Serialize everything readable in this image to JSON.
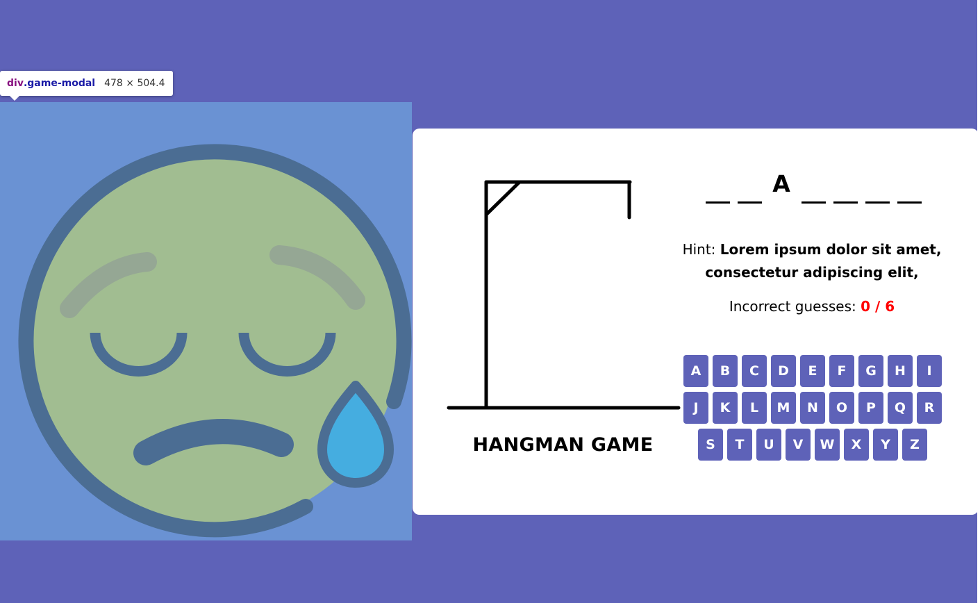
{
  "devtools_tooltip": {
    "tag": "div",
    "class_name": ".game-modal",
    "size": "478 × 504.4"
  },
  "emoji": {
    "icon": "sad-face-with-sweat-drop-icon",
    "colors": {
      "panel": "#6a92d3",
      "face": "#a1bd91",
      "outline": "#4b6d93",
      "brow": "#95a794",
      "tear": "#45ade0"
    }
  },
  "game": {
    "title": "HANGMAN GAME",
    "word_slots": [
      "",
      "",
      "A",
      "",
      "",
      "",
      ""
    ],
    "hint_label": "Hint: ",
    "hint_text": "Lorem ipsum dolor sit amet, consectetur adipiscing elit,",
    "guesses_label": "Incorrect guesses: ",
    "guesses_value": "0 / 6",
    "incorrect_count": 0,
    "max_guesses": 6,
    "keys": [
      "A",
      "B",
      "C",
      "D",
      "E",
      "F",
      "G",
      "H",
      "I",
      "J",
      "K",
      "L",
      "M",
      "N",
      "O",
      "P",
      "Q",
      "R",
      "S",
      "T",
      "U",
      "V",
      "W",
      "X",
      "Y",
      "Z"
    ]
  },
  "colors": {
    "background": "#5e62b8",
    "card": "#ffffff",
    "key": "#5e62b8",
    "key_text": "#ffffff",
    "guess_count": "#ff0000"
  }
}
